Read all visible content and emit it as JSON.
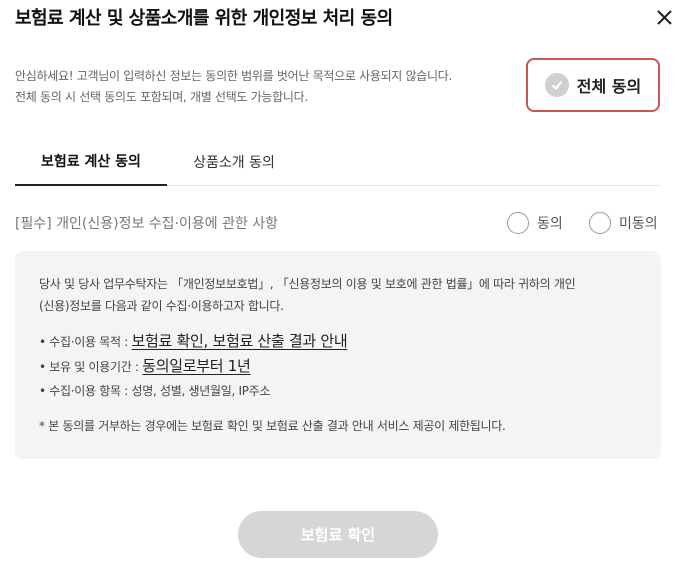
{
  "dialog": {
    "title": "보험료 계산 및 상품소개를 위한 개인정보 처리 동의",
    "close_icon": "close-icon"
  },
  "notice": {
    "line1": "안심하세요! 고객님이 입력하신 정보는 동의한 범위를 벗어난 목적으로 사용되지 않습니다.",
    "line2": "전체 동의 시 선택 동의도 포함되며, 개별 선택도 가능합니다."
  },
  "all_agree": {
    "label": "전체 동의",
    "checked": false,
    "border_color": "#c9574f"
  },
  "tabs": [
    {
      "label": "보험료 계산 동의",
      "active": true
    },
    {
      "label": "상품소개 동의",
      "active": false
    }
  ],
  "section": {
    "title": "[필수] 개인(신용)정보 수집·이용에 관한 사항",
    "agree_label": "동의",
    "disagree_label": "미동의"
  },
  "info": {
    "intro_line1": "당사 및 당사 업무수탁자는 「개인정보보호법」, 「신용정보의 이용 및 보호에 관한 법률」에 따라 귀하의 개인",
    "intro_line2": "(신용)정보를 다음과 같이 수집·이용하고자 합니다.",
    "items": [
      {
        "prefix": "• 수집·이용 목적 : ",
        "value": "보험료 확인, 보험료 산출 결과 안내"
      },
      {
        "prefix": "• 보유 및 이용기간 : ",
        "value": "동의일로부터 1년"
      },
      {
        "prefix": "• 수집·이용 항목 : 성명, 성별, 생년월일, IP주소",
        "value": ""
      }
    ],
    "footnote": "* 본 동의를 거부하는 경우에는 보험료 확인 및 보험료 산출 결과 안내 서비스 제공이 제한됩니다."
  },
  "confirm_button": {
    "label": "보험료 확인",
    "enabled": false
  }
}
